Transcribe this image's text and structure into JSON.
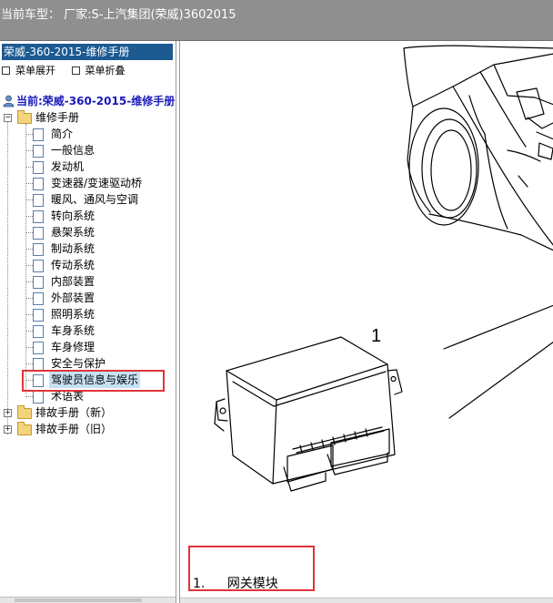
{
  "header": {
    "title": "当前车型： 厂家:S-上汽集团(荣威)3602015"
  },
  "sidebar": {
    "manual_header": "荣威-360-2015-维修手册",
    "expand_all": "菜单展开",
    "collapse_all": "菜单折叠",
    "current": "当前:荣威-360-2015-维修手册",
    "root_label": "维修手册",
    "items": [
      "简介",
      "一般信息",
      "发动机",
      "变速器/变速驱动桥",
      "暖风、通风与空调",
      "转向系统",
      "悬架系统",
      "制动系统",
      "传动系统",
      "内部装置",
      "外部装置",
      "照明系统",
      "车身系统",
      "车身修理",
      "安全与保护",
      "驾驶员信息与娱乐",
      "术语表"
    ],
    "selected_index": 15,
    "other_roots": [
      "排故手册（新）",
      "排故手册（旧）"
    ]
  },
  "content": {
    "callout_number": "1",
    "caption_number": "1.",
    "caption_text": "网关模块"
  },
  "colors": {
    "topbar": "#8f8f8f",
    "manual_header_bg": "#1c5a92",
    "current_text": "#1a1ab8",
    "selection_bg": "#c7e0f4",
    "annotation_red": "#e0343a"
  }
}
